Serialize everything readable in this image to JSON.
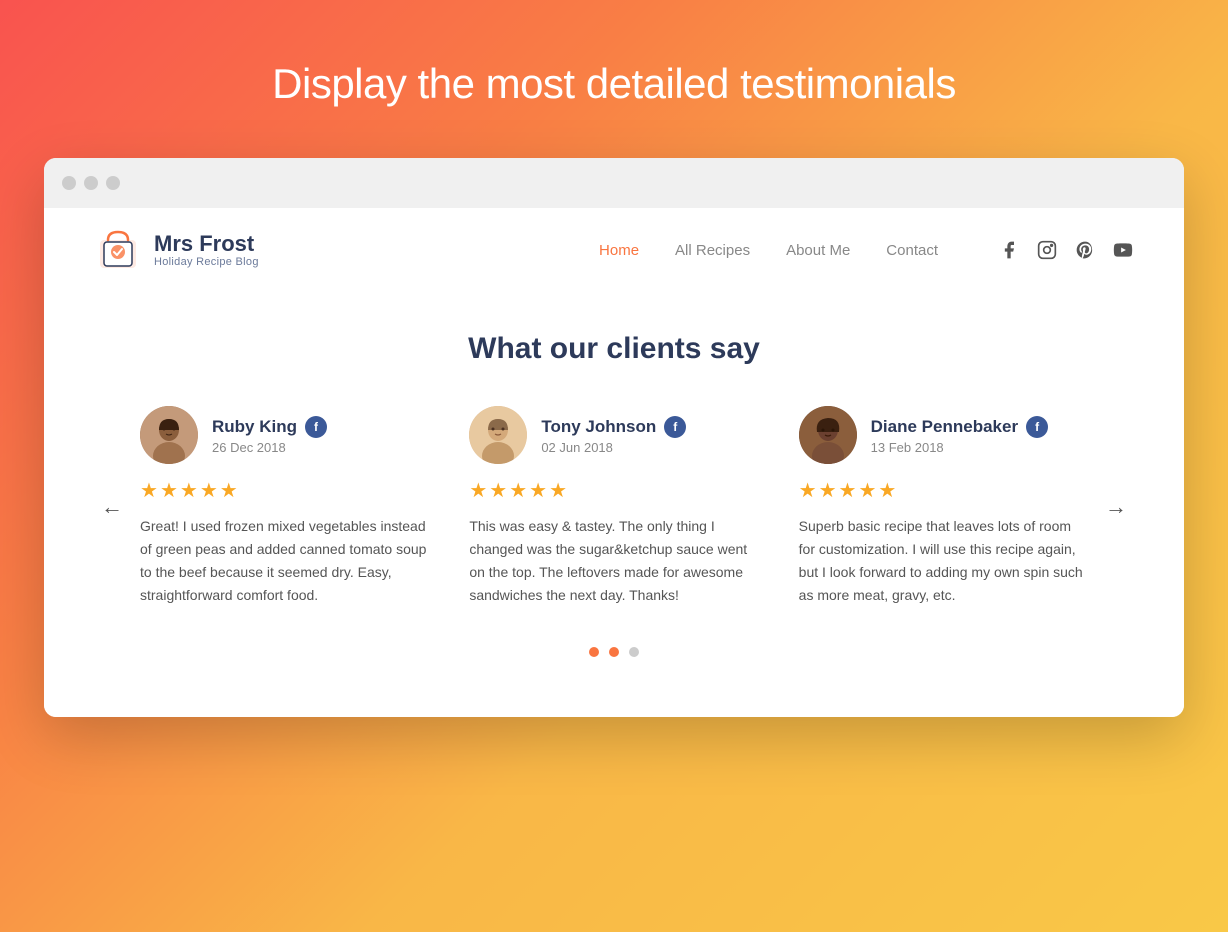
{
  "hero": {
    "title": "Display the most detailed testimonials"
  },
  "browser": {
    "dots": [
      "dot1",
      "dot2",
      "dot3"
    ]
  },
  "navbar": {
    "logo_name": "Mrs Frost",
    "logo_subtitle": "Holiday Recipe Blog",
    "links": [
      {
        "label": "Home",
        "active": true
      },
      {
        "label": "All Recipes",
        "active": false
      },
      {
        "label": "About Me",
        "active": false
      },
      {
        "label": "Contact",
        "active": false
      }
    ],
    "social": [
      {
        "name": "facebook-icon",
        "symbol": "f"
      },
      {
        "name": "instagram-icon",
        "symbol": "◻"
      },
      {
        "name": "pinterest-icon",
        "symbol": "p"
      },
      {
        "name": "youtube-icon",
        "symbol": "▶"
      }
    ]
  },
  "section": {
    "title": "What our clients say"
  },
  "testimonials": [
    {
      "name": "Ruby King",
      "date": "26 Dec 2018",
      "platform": "f",
      "stars": 5,
      "text": "Great! I used frozen mixed vegetables instead of green peas and added canned tomato soup to the beef because it seemed dry. Easy, straightforward comfort food.",
      "avatar_type": "ruby"
    },
    {
      "name": "Tony Johnson",
      "date": "02 Jun 2018",
      "platform": "f",
      "stars": 5,
      "text": "This was easy & tastey. The only thing I changed was the sugar&ketchup sauce went on the top. The leftovers made for awesome sandwiches the next day. Thanks!",
      "avatar_type": "tony"
    },
    {
      "name": "Diane Pennebaker",
      "date": "13 Feb 2018",
      "platform": "f",
      "stars": 5,
      "text": "Superb basic recipe that leaves lots of room for customization. I will use this recipe again, but I look forward to adding my own spin such as more meat, gravy, etc.",
      "avatar_type": "diane"
    }
  ],
  "pagination": {
    "dots": [
      {
        "active": true
      },
      {
        "active": true
      },
      {
        "active": false
      }
    ]
  },
  "arrows": {
    "left": "←",
    "right": "→"
  }
}
